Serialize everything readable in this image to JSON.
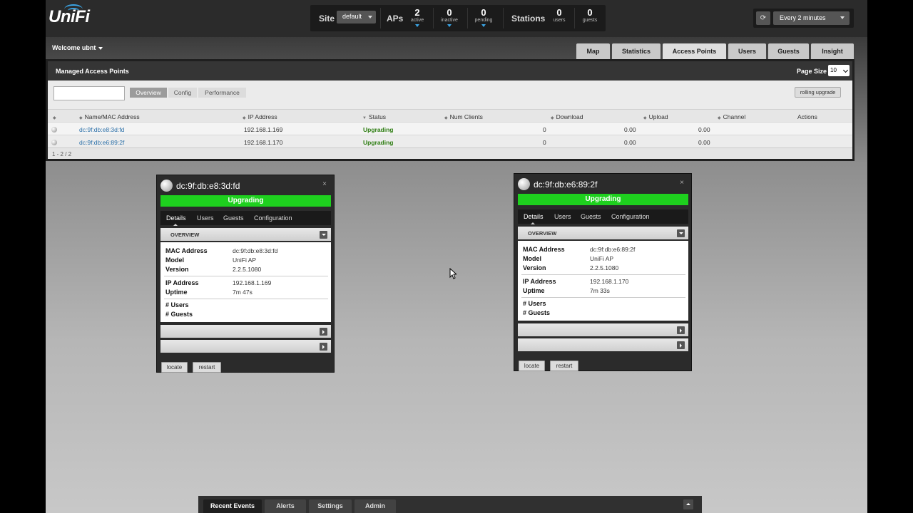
{
  "app": {
    "logo_text": "UniFi"
  },
  "header": {
    "site_label": "Site",
    "site_value": "default",
    "aps_label": "APs",
    "aps": [
      {
        "value": "2",
        "label": "active"
      },
      {
        "value": "0",
        "label": "inactive"
      },
      {
        "value": "0",
        "label": "pending"
      }
    ],
    "stations_label": "Stations",
    "stations": [
      {
        "value": "0",
        "label": "users"
      },
      {
        "value": "0",
        "label": "guests"
      }
    ],
    "refresh_value": "Every 2 minutes",
    "refresh_icon": "refresh-icon"
  },
  "welcome": "Welcome ubnt",
  "nav_tabs": [
    "Map",
    "Statistics",
    "Access Points",
    "Users",
    "Guests",
    "Insight"
  ],
  "nav_active": "Access Points",
  "panel": {
    "title": "Managed Access Points",
    "page_size_label": "Page Size",
    "page_size_value": "10",
    "subtabs": [
      "Overview",
      "Config",
      "Performance"
    ],
    "rolling_upgrade": "rolling upgrade",
    "columns": [
      "Name/MAC Address",
      "IP Address",
      "Status",
      "Num Clients",
      "Download",
      "Upload",
      "Channel",
      "Actions"
    ],
    "rows": [
      {
        "name": "dc:9f:db:e8:3d:fd",
        "ip": "192.168.1.169",
        "status": "Upgrading",
        "clients": "0",
        "download": "0.00",
        "upload": "0.00"
      },
      {
        "name": "dc:9f:db:e6:89:2f",
        "ip": "192.168.1.170",
        "status": "Upgrading",
        "clients": "0",
        "download": "0.00",
        "upload": "0.00"
      }
    ],
    "pager": "1 - 2 / 2"
  },
  "cards": [
    {
      "title": "dc:9f:db:e8:3d:fd",
      "status": "Upgrading",
      "tabs": [
        "Details",
        "Users",
        "Guests",
        "Configuration"
      ],
      "overview_title": "OVERVIEW",
      "mac_label": "MAC Address",
      "mac": "dc:9f:db:e8:3d:fd",
      "model_label": "Model",
      "model": "UniFi AP",
      "version_label": "Version",
      "version": "2.2.5.1080",
      "ip_label": "IP Address",
      "ip": "192.168.1.169",
      "uptime_label": "Uptime",
      "uptime": "7m 47s",
      "users_label": "# Users",
      "guests_label": "# Guests",
      "locate": "locate",
      "restart": "restart"
    },
    {
      "title": "dc:9f:db:e6:89:2f",
      "status": "Upgrading",
      "tabs": [
        "Details",
        "Users",
        "Guests",
        "Configuration"
      ],
      "overview_title": "OVERVIEW",
      "mac_label": "MAC Address",
      "mac": "dc:9f:db:e6:89:2f",
      "model_label": "Model",
      "model": "UniFi AP",
      "version_label": "Version",
      "version": "2.2.5.1080",
      "ip_label": "IP Address",
      "ip": "192.168.1.170",
      "uptime_label": "Uptime",
      "uptime": "7m 33s",
      "users_label": "# Users",
      "guests_label": "# Guests",
      "locate": "locate",
      "restart": "restart"
    }
  ],
  "bottom_tabs": [
    "Recent Events",
    "Alerts",
    "Settings",
    "Admin"
  ],
  "colors": {
    "status_green": "#1ed01e",
    "link_blue": "#2a6fa8",
    "accent_blue": "#3aa3e3"
  }
}
